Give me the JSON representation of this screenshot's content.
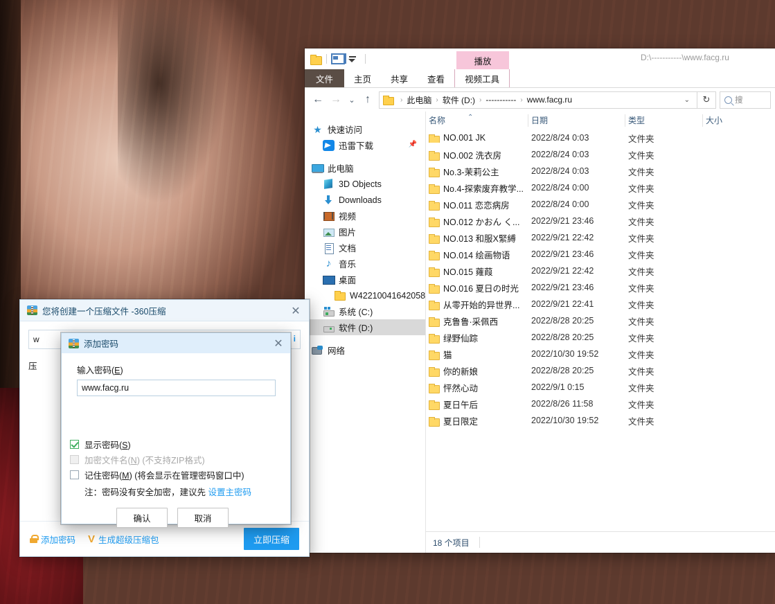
{
  "explorer": {
    "title_path": "D:\\-----------\\www.facg.ru",
    "quick_access_toolbar": {
      "folder_icon": "folder-icon",
      "properties_icon": "properties-icon",
      "customize_caret": "chevron-down-icon"
    },
    "ribbon": {
      "context_group_label": "播放",
      "tabs": [
        {
          "label": "文件",
          "type": "file"
        },
        {
          "label": "主页",
          "type": "normal"
        },
        {
          "label": "共享",
          "type": "normal"
        },
        {
          "label": "查看",
          "type": "normal"
        },
        {
          "label": "视频工具",
          "type": "context"
        }
      ]
    },
    "address": {
      "back_icon": "back-arrow-icon",
      "forward_icon": "forward-arrow-icon",
      "recent_icon": "chevron-down-icon",
      "up_icon": "up-arrow-icon",
      "breadcrumbs": [
        "此电脑",
        "软件 (D:)",
        "-----------",
        "www.facg.ru"
      ],
      "dropdown_icon": "chevron-down-icon",
      "refresh_icon": "refresh-icon",
      "search_placeholder": "搜",
      "search_icon": "search-icon"
    },
    "nav": {
      "items": [
        {
          "label": "快速访问",
          "icon": "star-icon",
          "indent": 0,
          "selected": false,
          "pinned": false
        },
        {
          "label": "迅雷下载",
          "icon": "xunlei-icon",
          "indent": 1,
          "selected": false,
          "pinned": true
        },
        {
          "label": "此电脑",
          "icon": "computer-icon",
          "indent": 0,
          "selected": false,
          "pinned": false,
          "spacer_before": true
        },
        {
          "label": "3D Objects",
          "icon": "3d-objects-icon",
          "indent": 1,
          "selected": false,
          "pinned": false
        },
        {
          "label": "Downloads",
          "icon": "downloads-icon",
          "indent": 1,
          "selected": false,
          "pinned": false
        },
        {
          "label": "视频",
          "icon": "videos-icon",
          "indent": 1,
          "selected": false,
          "pinned": false
        },
        {
          "label": "图片",
          "icon": "pictures-icon",
          "indent": 1,
          "selected": false,
          "pinned": false
        },
        {
          "label": "文档",
          "icon": "documents-icon",
          "indent": 1,
          "selected": false,
          "pinned": false
        },
        {
          "label": "音乐",
          "icon": "music-icon",
          "indent": 1,
          "selected": false,
          "pinned": false
        },
        {
          "label": "桌面",
          "icon": "desktop-icon",
          "indent": 1,
          "selected": false,
          "pinned": false
        },
        {
          "label": "W42210041642058",
          "icon": "folder-icon",
          "indent": 2,
          "selected": false,
          "pinned": false
        },
        {
          "label": "系统 (C:)",
          "icon": "drive-c-icon",
          "indent": 1,
          "selected": false,
          "pinned": false
        },
        {
          "label": "软件 (D:)",
          "icon": "drive-d-icon",
          "indent": 1,
          "selected": true,
          "pinned": false
        },
        {
          "label": "网络",
          "icon": "network-icon",
          "indent": 0,
          "selected": false,
          "pinned": false,
          "spacer_before": true
        }
      ]
    },
    "columns": {
      "name": "名称",
      "date": "日期",
      "type": "类型",
      "size": "大小",
      "sort_icon": "sort-ascending-icon"
    },
    "files": [
      {
        "name": "NO.001 JK",
        "date": "2022/8/24 0:03",
        "type": "文件夹",
        "size": ""
      },
      {
        "name": "NO.002 洗衣房",
        "date": "2022/8/24 0:03",
        "type": "文件夹",
        "size": ""
      },
      {
        "name": "No.3-茉莉公主",
        "date": "2022/8/24 0:03",
        "type": "文件夹",
        "size": ""
      },
      {
        "name": "No.4-探索废弃教学...",
        "date": "2022/8/24 0:00",
        "type": "文件夹",
        "size": ""
      },
      {
        "name": "NO.011 恋恋病房",
        "date": "2022/8/24 0:00",
        "type": "文件夹",
        "size": ""
      },
      {
        "name": "NO.012 かおん く...",
        "date": "2022/9/21 23:46",
        "type": "文件夹",
        "size": ""
      },
      {
        "name": "NO.013 和服X緊縛",
        "date": "2022/9/21 22:42",
        "type": "文件夹",
        "size": ""
      },
      {
        "name": "NO.014 绘画物语",
        "date": "2022/9/21 23:46",
        "type": "文件夹",
        "size": ""
      },
      {
        "name": "NO.015 蕹葭",
        "date": "2022/9/21 22:42",
        "type": "文件夹",
        "size": ""
      },
      {
        "name": "NO.016 夏日の时光",
        "date": "2022/9/21 23:46",
        "type": "文件夹",
        "size": ""
      },
      {
        "name": "从零开始的异世界...",
        "date": "2022/9/21 22:41",
        "type": "文件夹",
        "size": ""
      },
      {
        "name": "克鲁鲁·采佩西",
        "date": "2022/8/28 20:25",
        "type": "文件夹",
        "size": ""
      },
      {
        "name": "绿野仙踪",
        "date": "2022/8/28 20:25",
        "type": "文件夹",
        "size": ""
      },
      {
        "name": "猫",
        "date": "2022/10/30 19:52",
        "type": "文件夹",
        "size": ""
      },
      {
        "name": "你的新娘",
        "date": "2022/8/28 20:25",
        "type": "文件夹",
        "size": ""
      },
      {
        "name": "怦然心动",
        "date": "2022/9/1 0:15",
        "type": "文件夹",
        "size": ""
      },
      {
        "name": "夏日午后",
        "date": "2022/8/26 11:58",
        "type": "文件夹",
        "size": ""
      },
      {
        "name": "夏日限定",
        "date": "2022/10/30 19:52",
        "type": "文件夹",
        "size": ""
      }
    ],
    "status": "18 个项目"
  },
  "zip_dialog": {
    "title": "您将创建一个压缩文件 -360压缩",
    "app_icon": "360zip-icon",
    "close_icon": "close-icon",
    "path_value": "w",
    "info_icon": "info-icon",
    "left_label": "压",
    "footer": {
      "add_password_label": "添加密码",
      "lock_icon": "lock-icon",
      "super_zip_label": "生成超级压缩包",
      "v_icon": "v-icon",
      "compress_button": "立即压缩"
    }
  },
  "password_dialog": {
    "title": "添加密码",
    "app_icon": "360zip-icon",
    "close_icon": "close-icon",
    "field_label": "输入密码(E)",
    "password_value": "www.facg.ru",
    "checkboxes": [
      {
        "label": "显示密码(S)",
        "checked": true,
        "disabled": false
      },
      {
        "label": "加密文件名(N) (不支持ZIP格式)",
        "checked": false,
        "disabled": true
      },
      {
        "label": "记住密码(M) (将会显示在管理密码窗口中)",
        "checked": false,
        "disabled": false
      }
    ],
    "note_prefix": "注：密码没有安全加密，建议先 ",
    "note_link": "设置主密码",
    "confirm_button": "确认",
    "cancel_button": "取消"
  },
  "colors": {
    "accent_blue": "#1e9bf0",
    "context_pink": "#f7c6da",
    "file_tab_brown": "#5a4d45",
    "folder_yellow": "#ffd866",
    "selection_gray": "#d9d9d9"
  }
}
